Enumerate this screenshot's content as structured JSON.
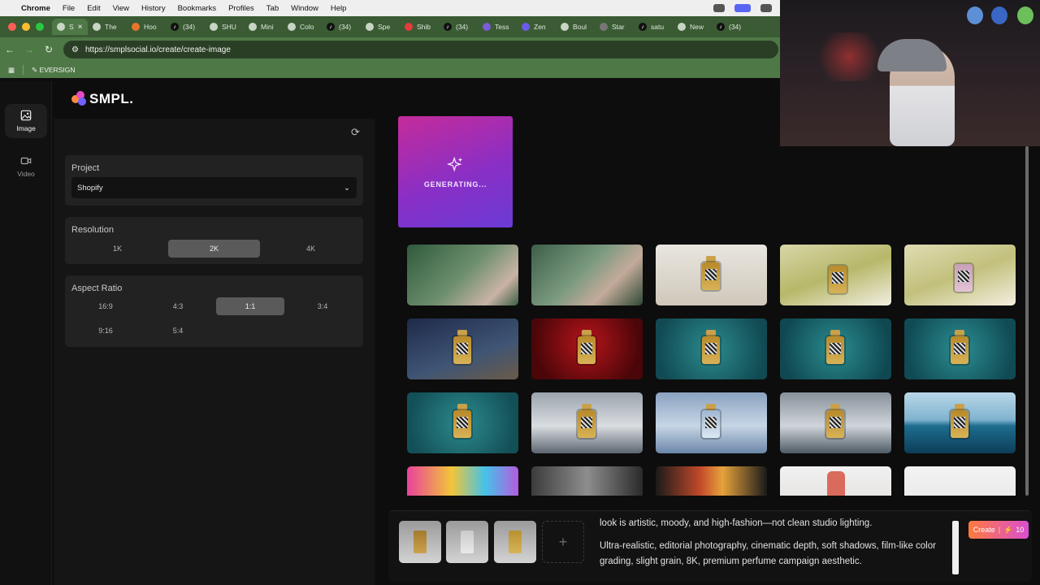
{
  "menubar": {
    "app": "Chrome",
    "items": [
      "File",
      "Edit",
      "View",
      "History",
      "Bookmarks",
      "Profiles",
      "Tab",
      "Window",
      "Help"
    ]
  },
  "tabs": [
    {
      "label": "S",
      "active": true
    },
    {
      "label": "The"
    },
    {
      "label": "Hoo"
    },
    {
      "label": "(34)"
    },
    {
      "label": "SHU"
    },
    {
      "label": "Mini"
    },
    {
      "label": "Colo"
    },
    {
      "label": "(34)"
    },
    {
      "label": "Spe"
    },
    {
      "label": "Shib"
    },
    {
      "label": "(34)"
    },
    {
      "label": "Tess"
    },
    {
      "label": "Zen"
    },
    {
      "label": "Boul"
    },
    {
      "label": "Star"
    },
    {
      "label": "satu"
    },
    {
      "label": "New"
    },
    {
      "label": "(34)"
    }
  ],
  "address": {
    "url": "https://smplsocial.io/create/create-image"
  },
  "bookmarks": {
    "item": "EVERSIGN"
  },
  "rail": {
    "image_label": "Image",
    "video_label": "Video"
  },
  "logo": {
    "text": "SMPL."
  },
  "project": {
    "title": "Project",
    "value": "Shopify"
  },
  "resolution": {
    "title": "Resolution",
    "options": [
      "1K",
      "2K",
      "4K"
    ],
    "selected": "2K"
  },
  "aspect": {
    "title": "Aspect Ratio",
    "options": [
      "16:9",
      "4:3",
      "1:1",
      "3:4",
      "9:16",
      "5:4"
    ],
    "selected": "1:1"
  },
  "generation": {
    "status": "GENERATING..."
  },
  "prompt": {
    "line1": "look is artistic, moody, and high-fashion—not clean studio lighting.",
    "line2": "Ultra-realistic, editorial photography, cinematic depth, soft shadows, film-like color grading, slight grain, 8K, premium perfume campaign aesthetic."
  },
  "create": {
    "label": "Create",
    "cost": "10"
  },
  "colors": {
    "accent_gradient_start": "#ff7a3d",
    "accent_gradient_end": "#d94fd0",
    "generating_start": "#c52b9a",
    "generating_end": "#6b3bd6",
    "chrome_green": "#4f7847"
  }
}
